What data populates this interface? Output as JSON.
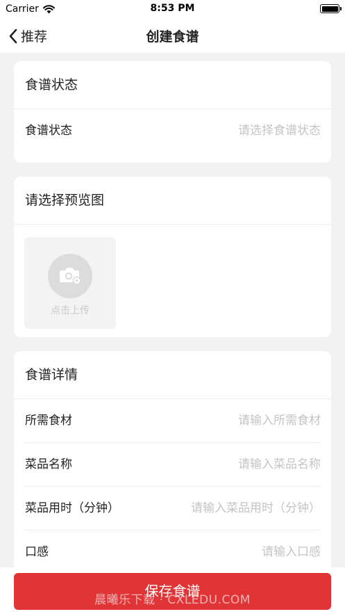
{
  "status_bar": {
    "carrier": "Carrier",
    "time": "8:53 PM"
  },
  "nav": {
    "back_label": "推荐",
    "title": "创建食谱"
  },
  "status_card": {
    "title": "食谱状态",
    "rows": [
      {
        "label": "食谱状态",
        "placeholder": "请选择食谱状态"
      }
    ]
  },
  "preview_card": {
    "title": "请选择预览图",
    "upload_hint": "点击上传"
  },
  "details_card": {
    "title": "食谱详情",
    "rows": [
      {
        "label": "所需食材",
        "placeholder": "请输入所需食材"
      },
      {
        "label": "菜品名称",
        "placeholder": "请输入菜品名称"
      },
      {
        "label": "菜品用时（分钟）",
        "placeholder": "请输入菜品用时（分钟）"
      },
      {
        "label": "口感",
        "placeholder": "请输入口感"
      }
    ]
  },
  "save_button": "保存食谱",
  "watermark": "晨曦乐下载 · CXLEDU.COM",
  "colors": {
    "accent": "#e03436",
    "background": "#f2f2f2",
    "placeholder": "#c4c4c4"
  }
}
